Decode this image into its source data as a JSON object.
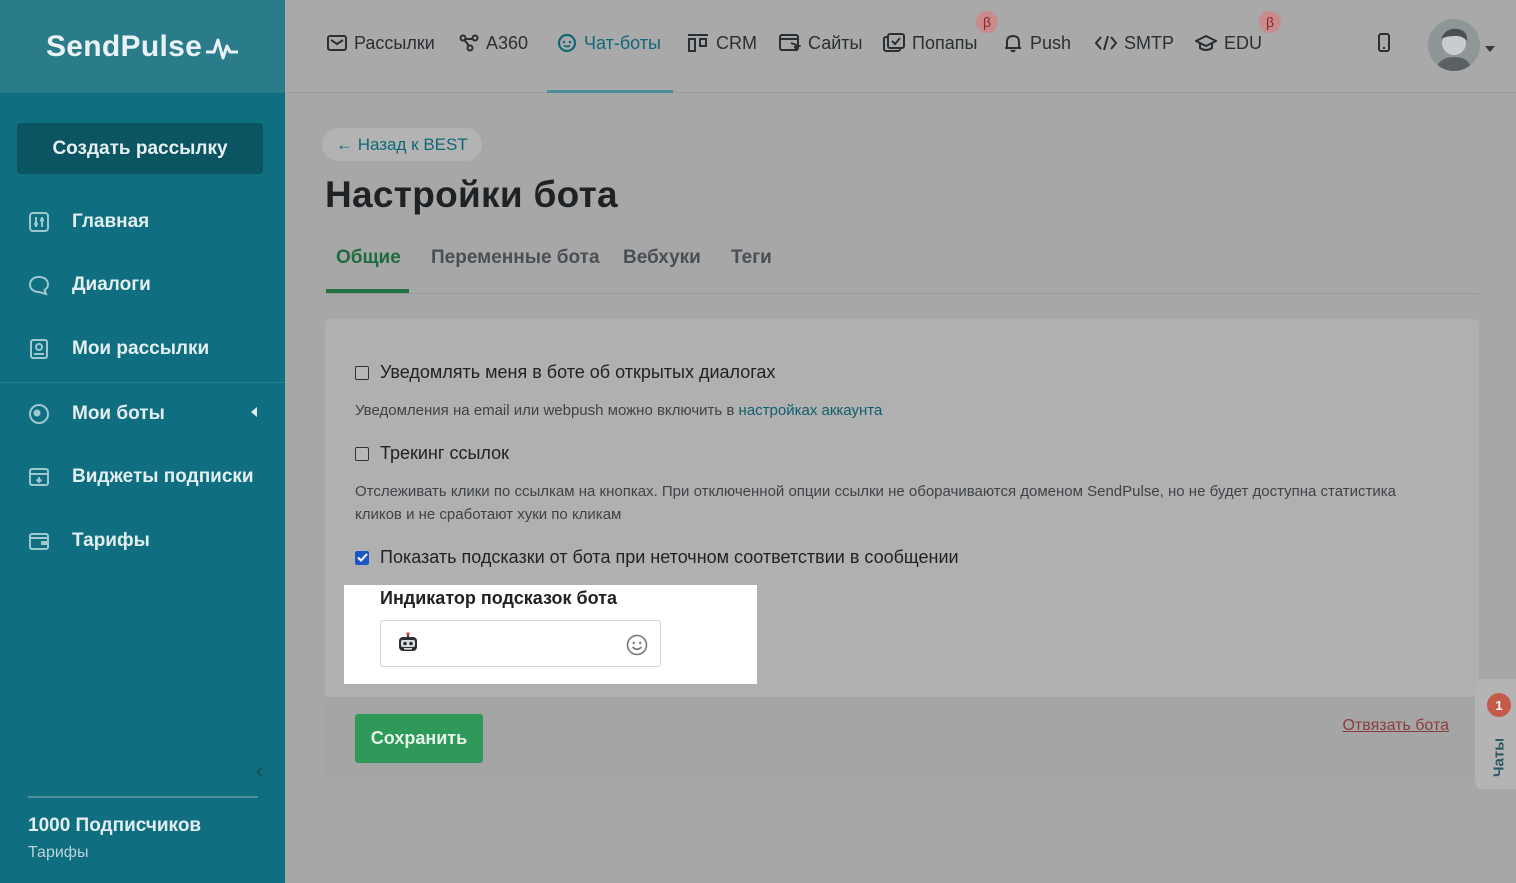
{
  "brand": "SendPulse",
  "sidebar": {
    "create_label": "Создать рассылку",
    "items": [
      {
        "label": "Главная",
        "icon": "sliders-icon"
      },
      {
        "label": "Диалоги",
        "icon": "chat-bubble-icon"
      },
      {
        "label": "Мои рассылки",
        "icon": "mail-box-icon"
      },
      {
        "label": "Мои боты",
        "icon": "globe-icon"
      },
      {
        "label": "Виджеты подписки",
        "icon": "widget-icon"
      },
      {
        "label": "Тарифы",
        "icon": "wallet-icon"
      }
    ],
    "subscribers": "1000 Подписчиков",
    "tariffs_link": "Тарифы"
  },
  "topnav": {
    "items": [
      {
        "label": "Рассылки",
        "icon": "envelope-icon"
      },
      {
        "label": "A360",
        "icon": "nodes-icon"
      },
      {
        "label": "Чат-боты",
        "icon": "chatbot-icon",
        "active": true
      },
      {
        "label": "CRM",
        "icon": "kanban-icon"
      },
      {
        "label": "Сайты",
        "icon": "browser-icon"
      },
      {
        "label": "Попапы",
        "icon": "popup-icon",
        "beta": true
      },
      {
        "label": "Push",
        "icon": "bell-icon"
      },
      {
        "label": "SMTP",
        "icon": "code-icon"
      },
      {
        "label": "EDU",
        "icon": "graduation-cap-icon",
        "beta": true
      }
    ],
    "beta_glyph": "β"
  },
  "main": {
    "back_label": "← Назад к BEST",
    "title": "Настройки бота",
    "tabs": [
      "Общие",
      "Переменные бота",
      "Вебхуки",
      "Теги"
    ],
    "options": {
      "notify_label": "Уведомлять меня в боте об открытых диалогах",
      "notify_checked": false,
      "notify_hint": "Уведомления на email или webpush можно включить в ",
      "notify_hint_link": "настройках аккаунта",
      "tracking_label": "Трекинг ссылок",
      "tracking_checked": false,
      "tracking_hint": "Отслеживать клики по ссылкам на кнопках. При отключенной опции ссылки не оборачиваются доменом SendPulse, но не будет доступна статистика кликов и не сработают хуки по кликам",
      "suggest_label": "Показать подсказки от бота при неточном соответствии в сообщении",
      "suggest_checked": true
    },
    "indicator": {
      "label": "Индикатор подсказок бота",
      "value_icon": "robot-emoji-icon"
    },
    "save_label": "Сохранить",
    "unlink_label": "Отвязать бота"
  },
  "chats_widget": {
    "label": "Чаты",
    "count": "1"
  },
  "colors": {
    "sidebar": "#0f6e7f",
    "primary_green": "#2e9958",
    "link": "#0f6878",
    "danger": "#8a3e3e"
  }
}
